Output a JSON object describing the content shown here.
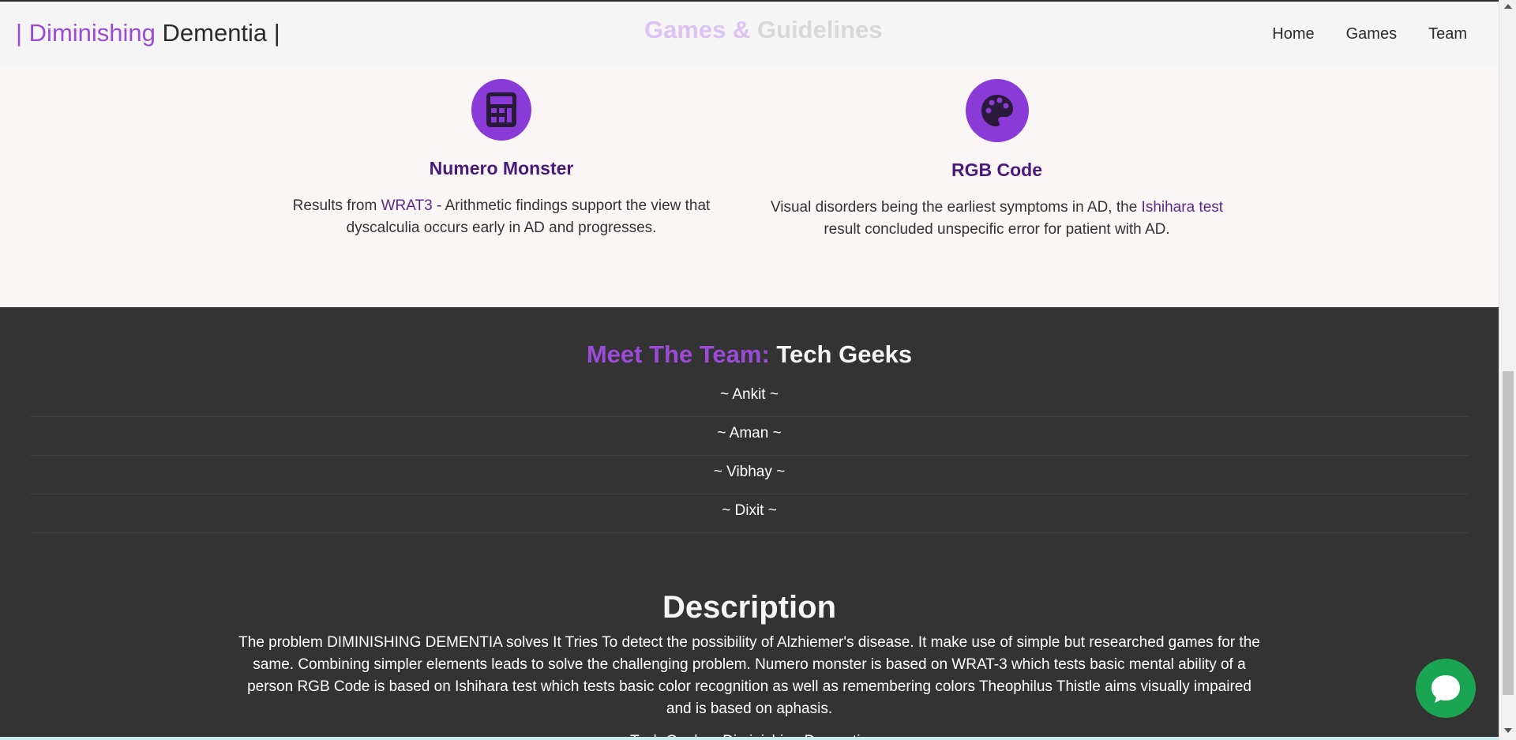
{
  "navbar": {
    "brand_left": "| Diminishing",
    "brand_right": " Dementia |",
    "heading_accent": "Games &",
    "heading_rest": " Guidelines",
    "links": [
      "Home",
      "Games",
      "Team"
    ]
  },
  "games": [
    {
      "icon": "calculator-icon",
      "title": "Numero Monster",
      "desc_before": "Results from ",
      "desc_link": "WRAT3",
      "desc_after": " - Arithmetic findings support the view that dyscalculia occurs early in AD and progresses."
    },
    {
      "icon": "palette-icon",
      "title": "RGB Code",
      "desc_before": "Visual disorders being the earliest symptoms in AD, the ",
      "desc_link": "Ishihara test",
      "desc_after": " result concluded unspecific error for patient with AD."
    }
  ],
  "team": {
    "heading_accent": "Meet The Team:",
    "heading_rest": " Tech Geeks",
    "members": [
      "~ Ankit ~",
      "~ Aman ~",
      "~ Vibhay ~",
      "~ Dixit ~"
    ]
  },
  "description": {
    "title": "Description",
    "text": "The problem DIMINISHING DEMENTIA solves It Tries To detect the possibility of Alzhiemer's disease. It make use of simple but researched games for the same. Combining simpler elements leads to solve the challenging problem. Numero monster is based on WRAT-3 which tests basic mental ability of a person RGB Code is based on Ishihara test which tests basic color recognition as well as remembering colors Theophilus Thistle aims visually impaired and is based on aphasis.",
    "more": "Tech Geeks · Diminishing Dementia"
  },
  "chat": {
    "icon": "chat-bubble-icon",
    "color": "#1aa553"
  },
  "colors": {
    "accent": "#8a3ad6",
    "dark": "#333333",
    "title": "#4a1a7a"
  }
}
